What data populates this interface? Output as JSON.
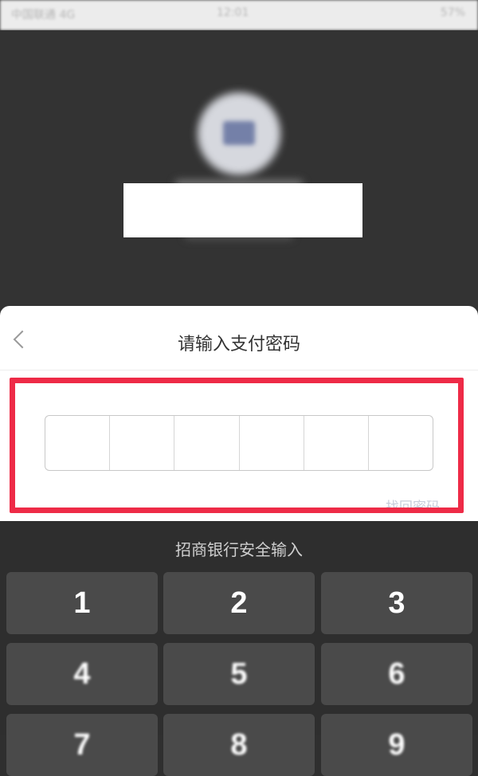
{
  "status_bar": {
    "carrier": "中国联通 4G",
    "time": "12:01",
    "battery": "57%"
  },
  "dialog": {
    "title": "请输入支付密码",
    "back_icon": "chevron-left-icon",
    "pin_length": 6,
    "forgot_password": "找回密码"
  },
  "keyboard": {
    "title": "招商银行安全输入",
    "keys": [
      "1",
      "2",
      "3",
      "4",
      "5",
      "6",
      "7",
      "8",
      "9"
    ]
  },
  "colors": {
    "highlight": "#ee2b47",
    "overlay_bg": "#2f2f2f",
    "key_bg": "#4a4a4a",
    "link": "#c7cdda"
  }
}
